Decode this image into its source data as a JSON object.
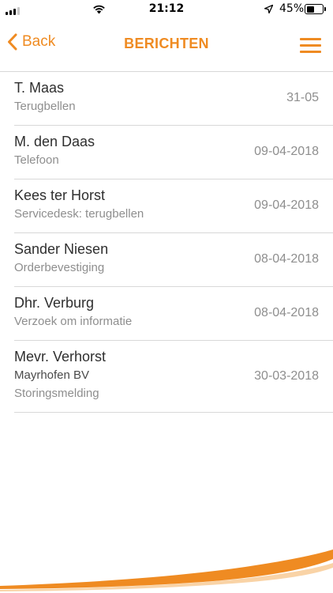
{
  "status": {
    "time": "21:12",
    "battery_pct": "45%"
  },
  "nav": {
    "back_label": "Back",
    "title": "BERICHTEN"
  },
  "messages": [
    {
      "name": "T. Maas",
      "subject": "Terugbellen",
      "date": "31-05"
    },
    {
      "name": "M. den Daas",
      "subject": "Telefoon",
      "date": "09-04-2018"
    },
    {
      "name": "Kees ter Horst",
      "subject": "Servicedesk: terugbellen",
      "date": "09-04-2018"
    },
    {
      "name": "Sander Niesen",
      "subject": "Orderbevestiging",
      "date": "08-04-2018"
    },
    {
      "name": "Dhr. Verburg",
      "subject": "Verzoek om informatie",
      "date": "08-04-2018"
    },
    {
      "name": "Mevr. Verhorst",
      "company": "Mayrhofen BV",
      "subject": "Storingsmelding",
      "date": "30-03-2018"
    }
  ],
  "colors": {
    "accent": "#ef8b22",
    "divider": "#d8d8d8"
  },
  "icons": {
    "signal": "cellular-signal-icon",
    "wifi": "wifi-icon",
    "location": "location-arrow-icon",
    "battery": "battery-icon",
    "back": "chevron-left-icon",
    "menu": "hamburger-menu-icon"
  }
}
